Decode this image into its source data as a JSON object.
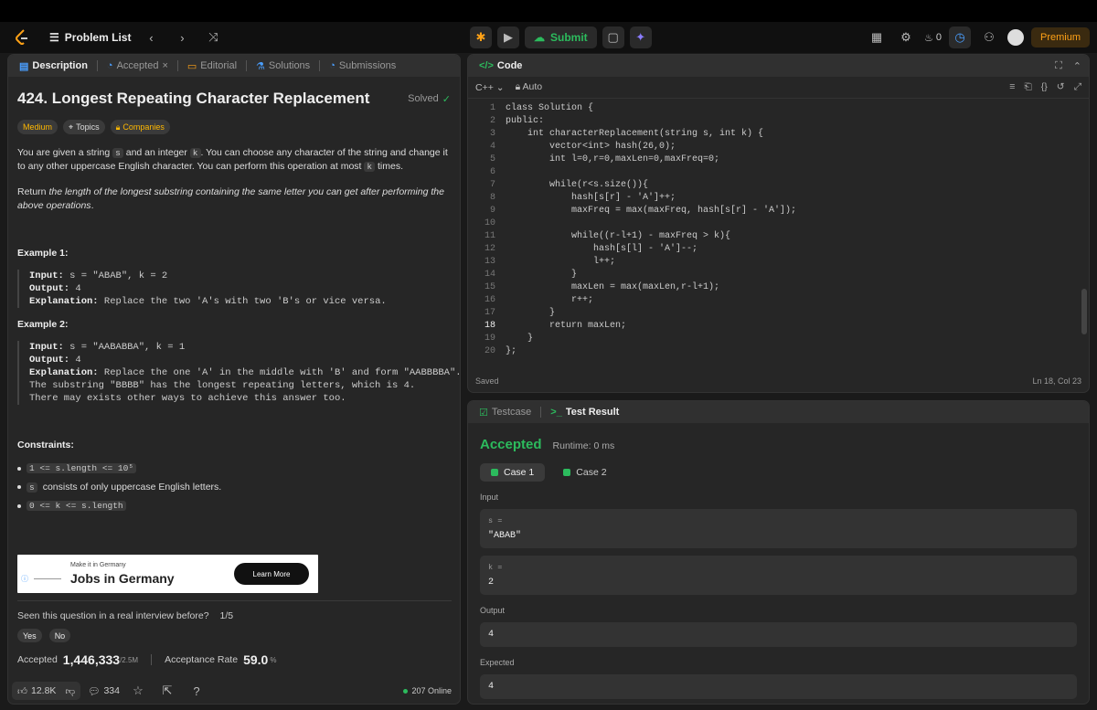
{
  "nav": {
    "problem_list": "Problem List",
    "submit_label": "Submit",
    "streak_count": "0",
    "premium_label": "Premium"
  },
  "left_tabs": [
    "Description",
    "Accepted",
    "Editorial",
    "Solutions",
    "Submissions"
  ],
  "problem": {
    "title": "424. Longest Repeating Character Replacement",
    "status": "Solved",
    "difficulty": "Medium",
    "topics_label": "Topics",
    "companies_label": "Companies",
    "desc1_a": "You are given a string ",
    "desc1_s": "s",
    "desc1_b": " and an integer ",
    "desc1_k": "k",
    "desc1_c": ". You can choose any character of the string and change it to any other uppercase English character. You can perform this operation at most ",
    "desc1_k2": "k",
    "desc1_d": " times.",
    "desc2_a": "Return ",
    "desc2_b": "the length of the longest substring containing the same letter you can get after performing the above operations",
    "desc2_c": ".",
    "example1_title": "Example 1:",
    "example1": {
      "input_label": "Input:",
      "input": " s = \"ABAB\", k = 2",
      "output_label": "Output:",
      "output": " 4",
      "expl_label": "Explanation:",
      "expl": " Replace the two 'A's with two 'B's or vice versa."
    },
    "example2_title": "Example 2:",
    "example2": {
      "input_label": "Input:",
      "input": " s = \"AABABBA\", k = 1",
      "output_label": "Output:",
      "output": " 4",
      "expl_label": "Explanation:",
      "expl": " Replace the one 'A' in the middle with 'B' and form \"AABBBBA\".\nThe substring \"BBBB\" has the longest repeating letters, which is 4.\nThere may exists other ways to achieve this answer too."
    },
    "constraints_title": "Constraints:",
    "constraint1": "1 <= s.length <= 10⁵",
    "constraint2_code": "s",
    "constraint2_text": "consists of only uppercase English letters.",
    "constraint3": "0 <= k <= s.length"
  },
  "ad": {
    "small": "Make it in Germany",
    "big": "Jobs in Germany",
    "button": "Learn More"
  },
  "interview": {
    "question": "Seen this question in a real interview before?",
    "progress": "1/5",
    "yes": "Yes",
    "no": "No"
  },
  "stats": {
    "accepted_label": "Accepted",
    "accepted_value": "1,446,333",
    "accepted_total": "/2.5M",
    "rate_label": "Acceptance Rate",
    "rate_value": "59.0",
    "rate_unit": "%"
  },
  "bottom": {
    "likes": "12.8K",
    "comments": "334",
    "online": "207 Online"
  },
  "code": {
    "tab": "Code",
    "language": "C++",
    "mode": "Auto",
    "status": "Saved",
    "cursor": "Ln 18, Col 23",
    "line_numbers": [
      "1",
      "2",
      "3",
      "4",
      "5",
      "6",
      "7",
      "8",
      "9",
      "10",
      "11",
      "12",
      "13",
      "14",
      "15",
      "16",
      "17",
      "18",
      "19",
      "20"
    ],
    "lines": [
      "class Solution {",
      "public:",
      "    int characterReplacement(string s, int k) {",
      "        vector<int> hash(26,0);",
      "        int l=0,r=0,maxLen=0,maxFreq=0;",
      "",
      "        while(r<s.size()){",
      "            hash[s[r] - 'A']++;",
      "            maxFreq = max(maxFreq, hash[s[r] - 'A']);",
      "",
      "            while((r-l+1) - maxFreq > k){",
      "                hash[s[l] - 'A']--;",
      "                l++;",
      "            }",
      "            maxLen = max(maxLen,r-l+1);",
      "            r++;",
      "        }",
      "        return maxLen;",
      "    }",
      "};"
    ]
  },
  "result": {
    "tab_testcase": "Testcase",
    "tab_result": "Test Result",
    "verdict": "Accepted",
    "runtime": "Runtime: 0 ms",
    "case1": "Case 1",
    "case2": "Case 2",
    "input_label": "Input",
    "s_label": "s =",
    "s_value": "\"ABAB\"",
    "k_label": "k =",
    "k_value": "2",
    "output_label": "Output",
    "output_value": "4",
    "expected_label": "Expected",
    "expected_value": "4"
  },
  "colors": {
    "accent_green": "#2cbb5d",
    "medium": "#ffb800",
    "premium": "#ffa116"
  }
}
